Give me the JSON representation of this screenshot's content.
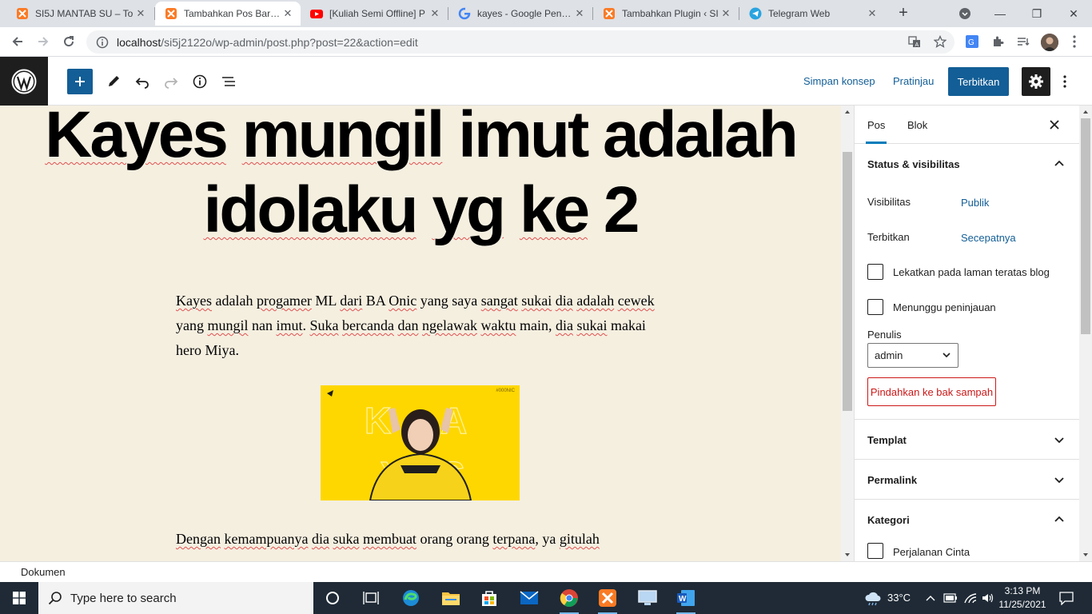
{
  "browser": {
    "tabs": [
      {
        "title": "SI5J MANTAB SU – To",
        "icon": "xampp-icon",
        "active": false
      },
      {
        "title": "Tambahkan Pos Baru ‹",
        "icon": "xampp-icon",
        "active": true
      },
      {
        "title": "[Kuliah Semi Offline] P",
        "icon": "youtube-icon",
        "active": false
      },
      {
        "title": "kayes - Google Penelu",
        "icon": "google-icon",
        "active": false
      },
      {
        "title": "Tambahkan Plugin ‹ SI",
        "icon": "xampp-icon",
        "active": false
      },
      {
        "title": "Telegram Web",
        "icon": "telegram-icon",
        "active": false
      }
    ],
    "url_host": "localhost",
    "url_path": "/si5j2122o/wp-admin/post.php?post=22&action=edit"
  },
  "editor_header": {
    "save_draft": "Simpan konsep",
    "preview": "Pratinjau",
    "publish": "Terbitkan"
  },
  "post": {
    "title_words": [
      "Kayes",
      "mungil",
      "imut",
      "adalah",
      "idolaku",
      "yg",
      "ke",
      "2"
    ],
    "paragraph1": [
      {
        "t": "Kayes",
        "s": true
      },
      {
        "t": " adalah ",
        "s": false
      },
      {
        "t": "progamer",
        "s": true
      },
      {
        "t": " ML ",
        "s": false
      },
      {
        "t": "dari",
        "s": true
      },
      {
        "t": " BA ",
        "s": false
      },
      {
        "t": "Onic",
        "s": true
      },
      {
        "t": " yang saya ",
        "s": false
      },
      {
        "t": "sangat",
        "s": true
      },
      {
        "t": " ",
        "s": false
      },
      {
        "t": "sukai",
        "s": true
      },
      {
        "t": " ",
        "s": false
      },
      {
        "t": "dia",
        "s": true
      },
      {
        "t": " ",
        "s": false
      },
      {
        "t": "adalah",
        "s": true
      },
      {
        "t": " ",
        "s": false
      },
      {
        "t": "cewek",
        "s": true
      },
      {
        "t": " yang ",
        "s": false
      },
      {
        "t": "mungil",
        "s": true
      },
      {
        "t": " nan ",
        "s": false
      },
      {
        "t": "imut",
        "s": true
      },
      {
        "t": ". ",
        "s": false
      },
      {
        "t": "Suka",
        "s": true
      },
      {
        "t": " ",
        "s": false
      },
      {
        "t": "bercanda",
        "s": true
      },
      {
        "t": " ",
        "s": false
      },
      {
        "t": "dan",
        "s": true
      },
      {
        "t": " ",
        "s": false
      },
      {
        "t": "ngelawak",
        "s": true
      },
      {
        "t": " ",
        "s": false
      },
      {
        "t": "waktu",
        "s": true
      },
      {
        "t": " main, ",
        "s": false
      },
      {
        "t": "dia",
        "s": true
      },
      {
        "t": " ",
        "s": false
      },
      {
        "t": "sukai",
        "s": true
      },
      {
        "t": " makai hero Miya.",
        "s": false
      }
    ],
    "paragraph2": [
      {
        "t": "Dengan",
        "s": true
      },
      {
        "t": " ",
        "s": false
      },
      {
        "t": "kemampuanya",
        "s": true
      },
      {
        "t": " ",
        "s": false
      },
      {
        "t": "dia",
        "s": true
      },
      {
        "t": " ",
        "s": false
      },
      {
        "t": "suka",
        "s": true
      },
      {
        "t": " ",
        "s": false
      },
      {
        "t": "membuat",
        "s": true
      },
      {
        "t": " orang orang ",
        "s": false
      },
      {
        "t": "terpana",
        "s": true
      },
      {
        "t": ", ya ",
        "s": false
      },
      {
        "t": "gitulah",
        "s": true
      }
    ],
    "image_label": "#000NIC"
  },
  "sidebar": {
    "tabs": [
      "Pos",
      "Blok"
    ],
    "status_panel": {
      "title": "Status & visibilitas",
      "visibility_label": "Visibilitas",
      "visibility_value": "Publik",
      "publish_label": "Terbitkan",
      "publish_value": "Secepatnya",
      "sticky_label": "Lekatkan pada laman teratas blog",
      "pending_label": "Menunggu peninjauan",
      "author_label": "Penulis",
      "author_value": "admin",
      "trash_label": "Pindahkan ke bak sampah"
    },
    "template_panel": "Templat",
    "permalink_panel": "Permalink",
    "category_panel": "Kategori",
    "category_item": "Perjalanan Cinta"
  },
  "footer": {
    "breadcrumb": "Dokumen"
  },
  "taskbar": {
    "search_placeholder": "Type here to search",
    "weather": "33°C",
    "time": "3:13 PM",
    "date": "11/25/2021"
  },
  "colors": {
    "wp_blue": "#135e96",
    "canvas_bg": "#f5efe0",
    "image_yellow": "#fed700",
    "taskbar": "#1f2a36"
  }
}
